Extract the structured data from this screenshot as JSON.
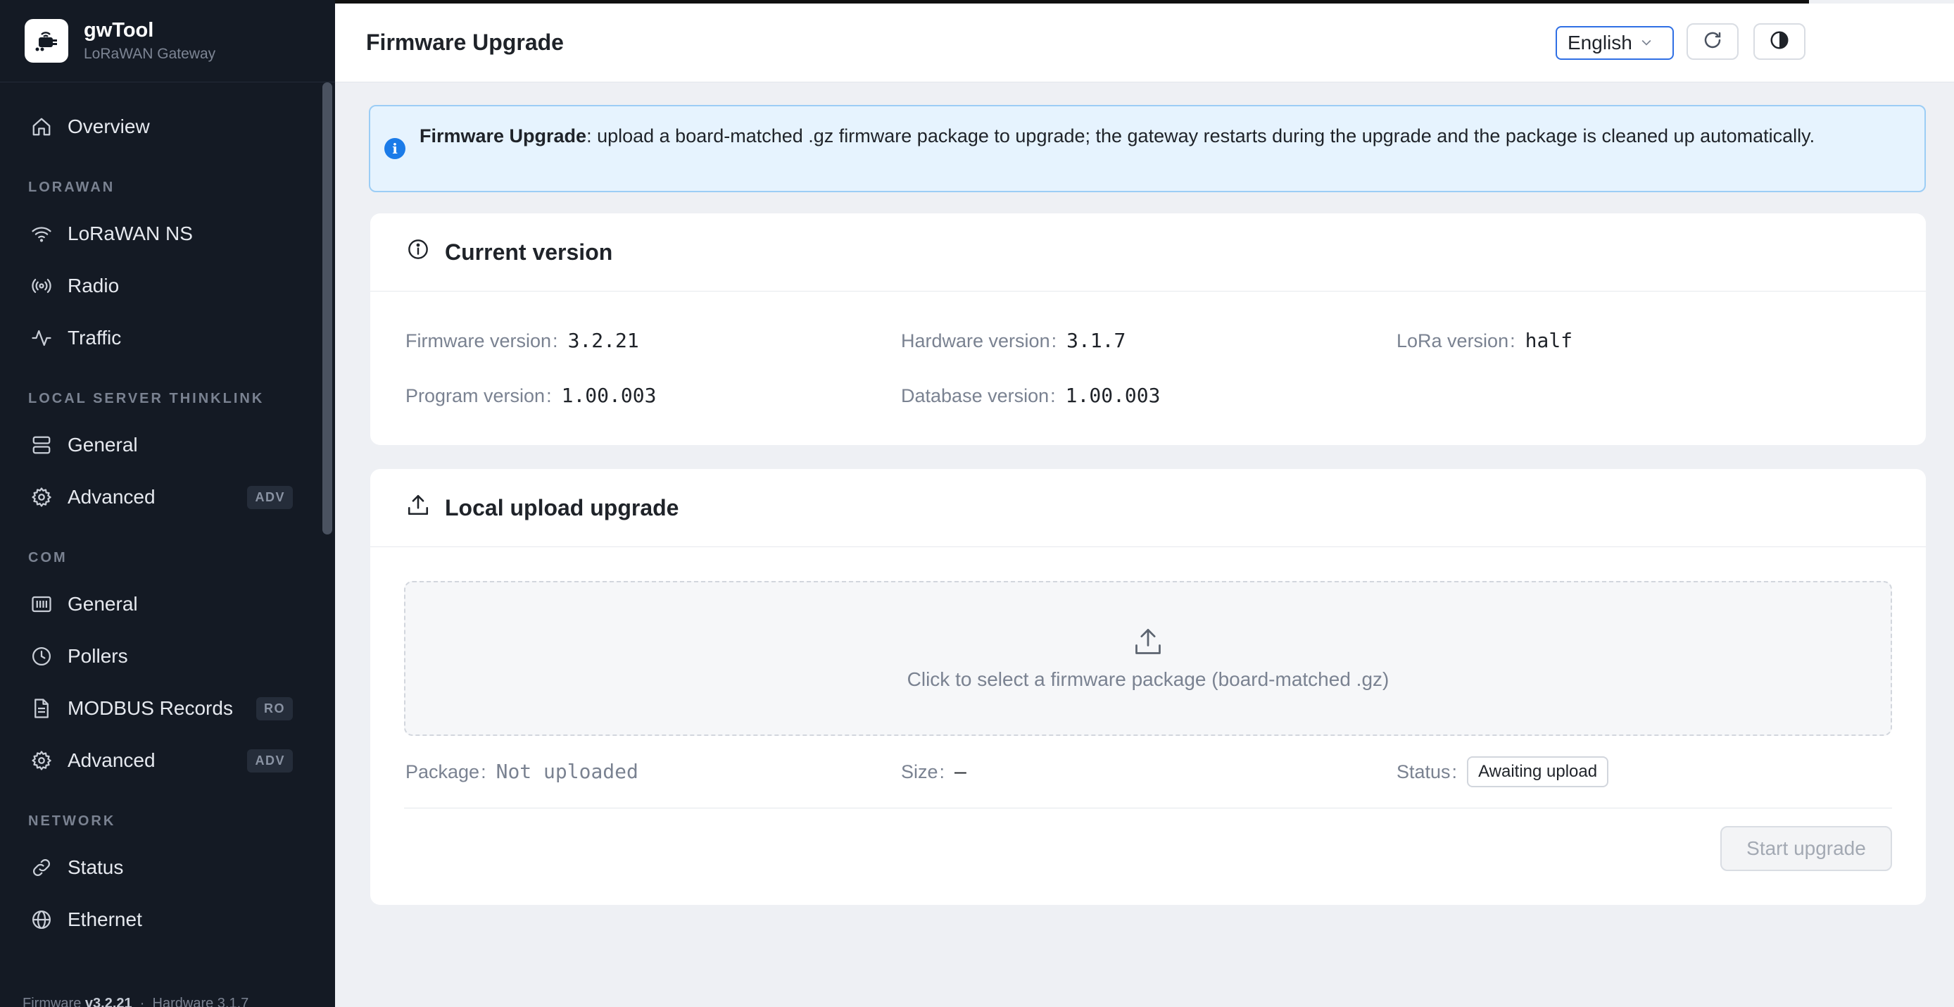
{
  "app": {
    "name": "gwTool",
    "subtitle": "LoRaWAN Gateway",
    "logo": "gateway-logo-icon"
  },
  "sidebar": {
    "overview": {
      "label": "Overview",
      "icon": "home-icon"
    },
    "sections": {
      "lorawan": {
        "title": "LORAWAN",
        "items": [
          {
            "label": "LoRaWAN NS",
            "icon": "wifi-icon"
          },
          {
            "label": "Radio",
            "icon": "radio-icon"
          },
          {
            "label": "Traffic",
            "icon": "activity-icon"
          }
        ]
      },
      "local_server": {
        "title": "LOCAL SERVER THINKLINK",
        "items": [
          {
            "label": "General",
            "icon": "server-icon"
          },
          {
            "label": "Advanced",
            "icon": "gear-icon",
            "badge": "ADV"
          }
        ]
      },
      "com": {
        "title": "COM",
        "items": [
          {
            "label": "General",
            "icon": "serial-port-icon"
          },
          {
            "label": "Pollers",
            "icon": "clock-icon"
          },
          {
            "label": "MODBUS Records",
            "icon": "document-icon",
            "badge": "RO"
          },
          {
            "label": "Advanced",
            "icon": "gear-icon",
            "badge": "ADV"
          }
        ]
      },
      "network": {
        "title": "NETWORK",
        "items": [
          {
            "label": "Status",
            "icon": "link-icon"
          },
          {
            "label": "Ethernet",
            "icon": "globe-icon"
          }
        ]
      }
    },
    "footer": {
      "firmware_label": "Firmware",
      "firmware_value": "v3.2.21",
      "hardware_label": "Hardware",
      "hardware_value": "3.1.7"
    }
  },
  "header": {
    "title": "Firmware Upgrade",
    "language": "English",
    "refresh_icon": "refresh-icon",
    "theme_icon": "theme-toggle-icon"
  },
  "alert": {
    "bold": "Firmware Upgrade",
    "text": ": upload a board-matched .gz firmware package to upgrade; the gateway restarts during the upgrade and the package is cleaned up automatically.",
    "color": "#1b7be8"
  },
  "current_version": {
    "title": "Current version",
    "firmware": {
      "label": "Firmware version",
      "value": "3.2.21"
    },
    "hardware": {
      "label": "Hardware version",
      "value": "3.1.7"
    },
    "lora": {
      "label": "LoRa version",
      "value": "half"
    },
    "program": {
      "label": "Program version",
      "value": "1.00.003"
    },
    "database": {
      "label": "Database version",
      "value": "1.00.003"
    }
  },
  "upload": {
    "title": "Local upload upgrade",
    "dropzone_text": "Click to select a firmware package (board-matched .gz)",
    "package": {
      "label": "Package",
      "value": "Not uploaded"
    },
    "size": {
      "label": "Size",
      "value": "—"
    },
    "status": {
      "label": "Status",
      "value": "Awaiting upload"
    },
    "start_button": "Start upgrade"
  }
}
